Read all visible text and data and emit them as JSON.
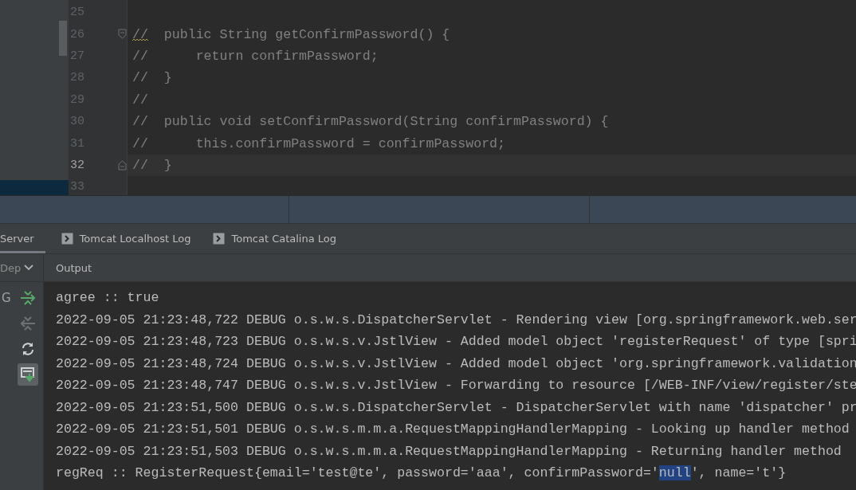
{
  "editor": {
    "lines": [
      {
        "number": "25",
        "current": false,
        "kind": "plain",
        "warning": false
      },
      {
        "number": "26",
        "text": "//  public String getConfirmPassword() {",
        "current": false,
        "kind": "fold-start",
        "warning": true
      },
      {
        "number": "27",
        "text": "//      return confirmPassword;",
        "current": false,
        "kind": "plain",
        "warning": false
      },
      {
        "number": "28",
        "text": "//  }",
        "current": false,
        "kind": "plain",
        "warning": false
      },
      {
        "number": "29",
        "text": "//",
        "current": false,
        "kind": "plain",
        "warning": false
      },
      {
        "number": "30",
        "text": "//  public void setConfirmPassword(String confirmPassword) {",
        "current": false,
        "kind": "plain",
        "warning": false
      },
      {
        "number": "31",
        "text": "//      this.confirmPassword = confirmPassword;",
        "current": false,
        "kind": "plain",
        "warning": false
      },
      {
        "number": "32",
        "text": "//  }",
        "current": true,
        "kind": "fold-end",
        "warning": false
      },
      {
        "number": "33",
        "current": false,
        "kind": "plain",
        "warning": false
      }
    ]
  },
  "tool_tabs": [
    {
      "label": "Server",
      "kind": "plain",
      "selected": true
    },
    {
      "label": "Tomcat Localhost Log",
      "kind": "log",
      "selected": false
    },
    {
      "label": "Tomcat Catalina Log",
      "kind": "log",
      "selected": false
    }
  ],
  "deployment": {
    "dropdown": "Dep",
    "column_label": "G"
  },
  "toolbar": [
    {
      "kind": "deploy",
      "disabled": false,
      "on": false
    },
    {
      "kind": "undeploy",
      "disabled": true,
      "on": false
    },
    {
      "kind": "refresh",
      "disabled": false,
      "on": false
    },
    {
      "kind": "scroll-end",
      "disabled": false,
      "on": true
    }
  ],
  "output": {
    "title": "Output",
    "lines": [
      [
        {
          "text": "agree :: true",
          "selected": false
        }
      ],
      [
        {
          "text": "2022-09-05 21:23:48,722 DEBUG o.s.w.s.DispatcherServlet - Rendering view [org.springframework.web.ser",
          "selected": false
        }
      ],
      [
        {
          "text": "2022-09-05 21:23:48,723 DEBUG o.s.w.s.v.JstlView - Added model object 'registerRequest' of type [spri",
          "selected": false
        }
      ],
      [
        {
          "text": "2022-09-05 21:23:48,724 DEBUG o.s.w.s.v.JstlView - Added model object 'org.springframework.validation",
          "selected": false
        }
      ],
      [
        {
          "text": "2022-09-05 21:23:48,747 DEBUG o.s.w.s.v.JstlView - Forwarding to resource [/WEB-INF/view/register/ste",
          "selected": false
        }
      ],
      [
        {
          "text": "2022-09-05 21:23:51,500 DEBUG o.s.w.s.DispatcherServlet - DispatcherServlet with name 'dispatcher' pr",
          "selected": false
        }
      ],
      [
        {
          "text": "2022-09-05 21:23:51,501 DEBUG o.s.w.s.m.m.a.RequestMappingHandlerMapping - Looking up handler method",
          "selected": false
        }
      ],
      [
        {
          "text": "2022-09-05 21:23:51,503 DEBUG o.s.w.s.m.m.a.RequestMappingHandlerMapping - Returning handler method",
          "selected": false
        }
      ],
      [
        {
          "text": "regReq :: RegisterRequest{email='test@te', password='aaa', confirmPassword='",
          "selected": false
        },
        {
          "text": "null",
          "selected": true
        },
        {
          "text": "', name='t'}",
          "selected": false
        }
      ]
    ]
  }
}
